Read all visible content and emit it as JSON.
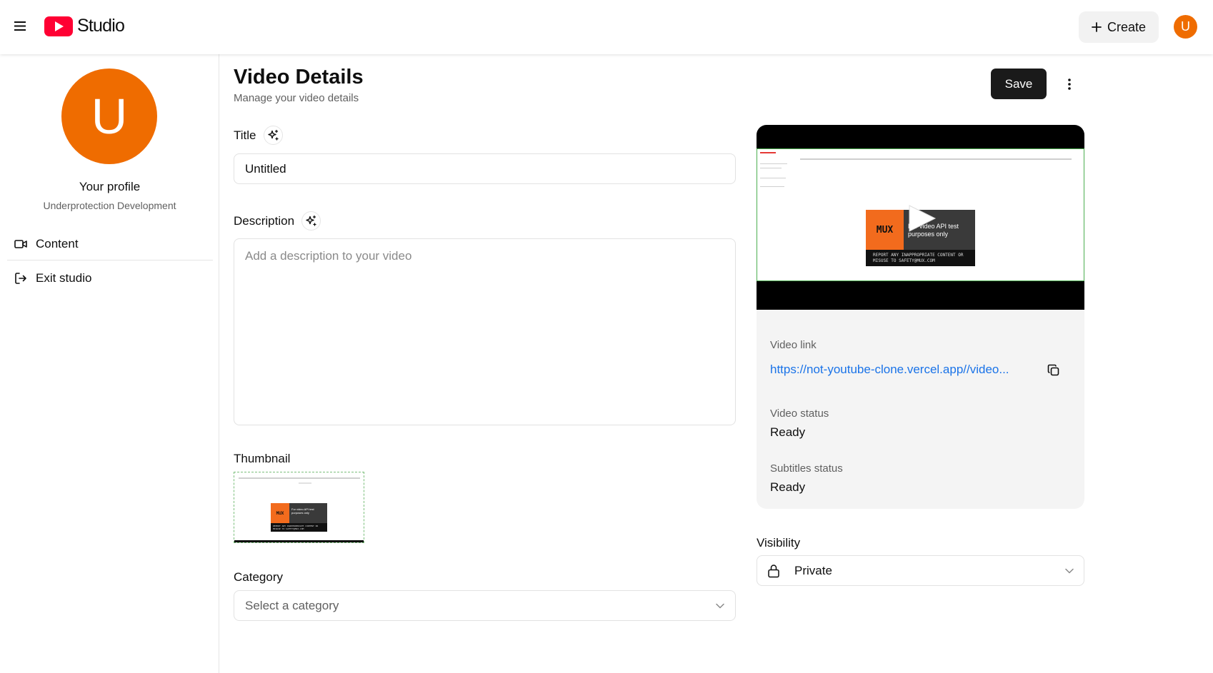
{
  "header": {
    "app_name": "Studio",
    "create_label": "Create",
    "avatar_initial": "U",
    "brand_color": "#ff0033",
    "avatar_color": "#ef6c00"
  },
  "sidebar": {
    "avatar_initial": "U",
    "profile_name": "Your profile",
    "profile_subtitle": "Underprotection Development",
    "items": [
      {
        "label": "Content",
        "icon": "video-camera-icon"
      },
      {
        "label": "Exit studio",
        "icon": "log-out-icon"
      }
    ]
  },
  "main": {
    "title": "Video Details",
    "subtitle": "Manage your video details",
    "save_label": "Save",
    "fields": {
      "title_label": "Title",
      "title_value": "Untitled",
      "description_label": "Description",
      "description_placeholder": "Add a description to your video",
      "thumbnail_label": "Thumbnail",
      "category_label": "Category",
      "category_placeholder": "Select a category"
    },
    "thumbnail": {
      "mux_logo": "MUX",
      "caption": "For video API test purposes only",
      "warning": "REPORT ANY INAPPROPRIATE CONTENT OR MISUSE TO SAFETY@MUX.COM"
    }
  },
  "video_panel": {
    "player": {
      "mux_logo": "MUX",
      "caption": "For video API test purposes only",
      "warning": "REPORT ANY INAPPROPRIATE CONTENT OR MISUSE TO SAFETY@MUX.COM"
    },
    "video_link_label": "Video link",
    "video_link": "https://not-youtube-clone.vercel.app//video...",
    "video_status_label": "Video status",
    "video_status": "Ready",
    "subtitles_status_label": "Subtitles status",
    "subtitles_status": "Ready",
    "link_color": "#1a73e8"
  },
  "visibility": {
    "label": "Visibility",
    "value": "Private",
    "icon": "lock-icon"
  }
}
